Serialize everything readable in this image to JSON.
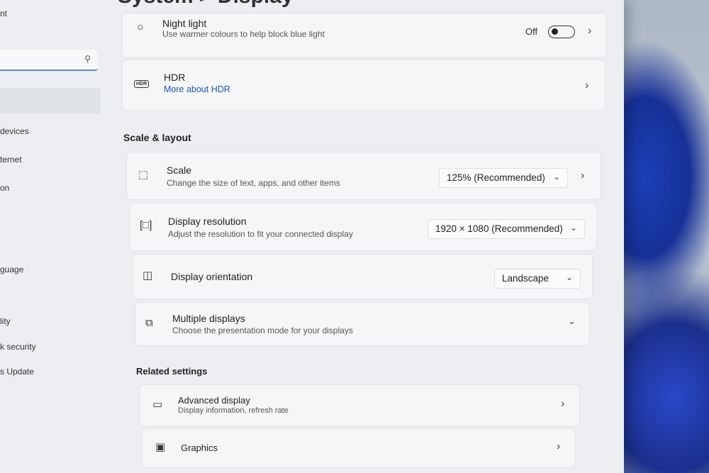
{
  "window": {
    "title": "System > Display",
    "title_fragment": "nt"
  },
  "sidebar": {
    "search_placeholder": "",
    "items": [
      {
        "label": "devices"
      },
      {
        "label": "ternet"
      },
      {
        "label": "on"
      },
      {
        "label": "guage"
      },
      {
        "label": "lity"
      },
      {
        "label": "k security"
      },
      {
        "label": "s Update"
      }
    ]
  },
  "night_light": {
    "title": "Night light",
    "subtitle": "Use warmer colours to help block blue light",
    "toggle_label": "Off"
  },
  "hdr": {
    "title": "HDR",
    "link": "More about HDR",
    "badge": "HDR"
  },
  "scale_layout": {
    "heading": "Scale & layout",
    "scale": {
      "title": "Scale",
      "subtitle": "Change the size of text, apps, and other items",
      "value": "125% (Recommended)"
    },
    "resolution": {
      "title": "Display resolution",
      "subtitle": "Adjust the resolution to fit your connected display",
      "value": "1920 × 1080 (Recommended)"
    },
    "orientation": {
      "title": "Display orientation",
      "value": "Landscape"
    },
    "multiple": {
      "title": "Multiple displays",
      "subtitle": "Choose the presentation mode for your displays"
    }
  },
  "related": {
    "heading": "Related settings",
    "advanced": {
      "title": "Advanced display",
      "subtitle": "Display information, refresh rate"
    },
    "graphics": {
      "title": "Graphics"
    }
  },
  "icons": {
    "search": "search-icon",
    "night_light": "sun-icon",
    "hdr": "hdr-icon",
    "scale": "scale-icon",
    "resolution": "resolution-icon",
    "orientation": "orientation-icon",
    "multiple": "multiple-displays-icon",
    "advanced": "monitor-icon",
    "graphics": "graphics-card-icon",
    "chevron_right": "chevron-right-icon",
    "chevron_down": "chevron-down-icon"
  }
}
